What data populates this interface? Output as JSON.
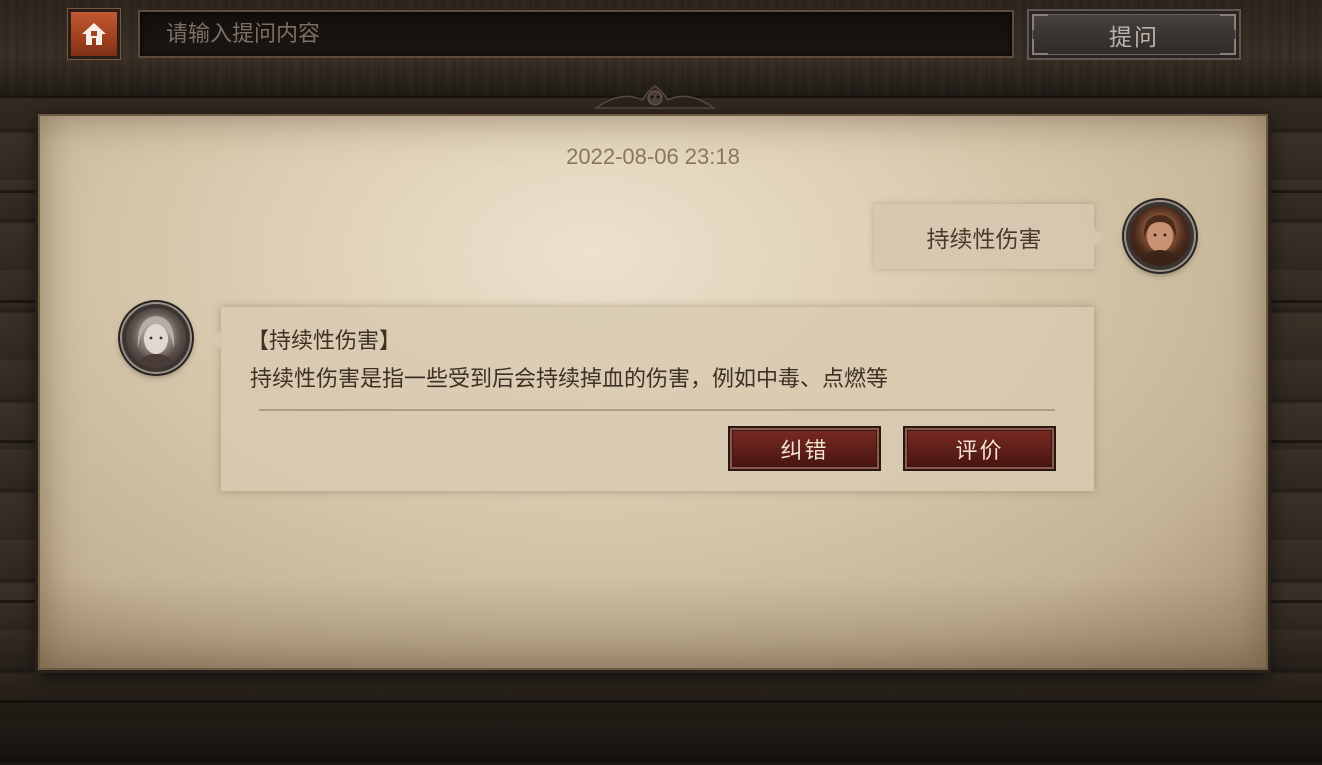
{
  "header": {
    "home_icon": "home-icon",
    "search": {
      "placeholder": "请输入提问内容",
      "value": ""
    },
    "ask_label": "提问"
  },
  "chat": {
    "timestamp": "2022-08-06 23:18",
    "user_message": "持续性伤害",
    "answer": {
      "title": "【持续性伤害】",
      "body": "持续性伤害是指一些受到后会持续掉血的伤害，例如中毒、点燃等",
      "correct_label": "纠错",
      "rate_label": "评价"
    }
  },
  "colors": {
    "parchment": "#cdbb9a",
    "home_button": "#a2421f",
    "action_button": "#5e1e18",
    "ask_button": "#3a3532",
    "text_dark": "#3f3024",
    "timestamp": "#8a7660"
  }
}
